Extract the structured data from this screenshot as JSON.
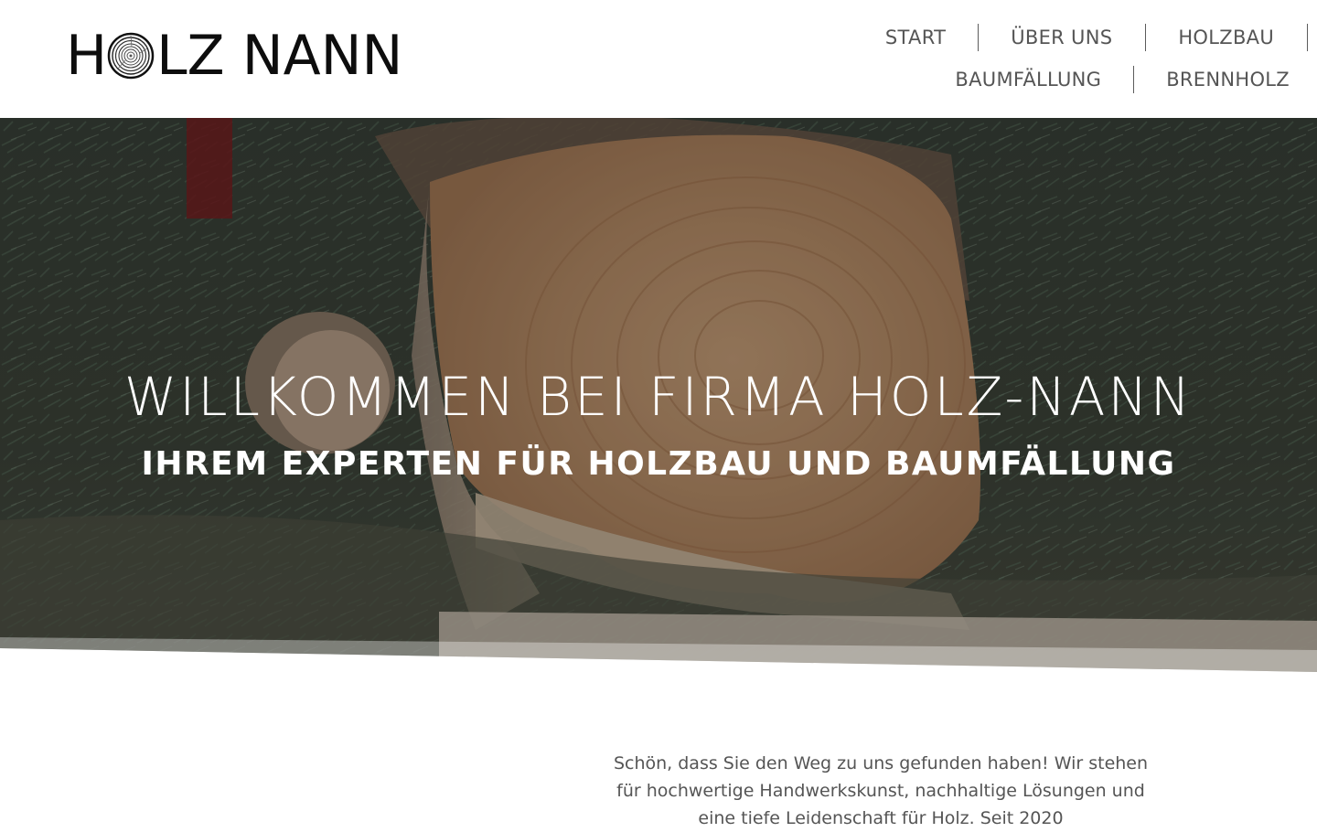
{
  "logo": {
    "before": "H",
    "ring_icon": "tree-ring-icon",
    "after": "LZ NANN"
  },
  "nav": {
    "row1": [
      {
        "label": "START"
      },
      {
        "label": "ÜBER UNS"
      },
      {
        "label": "HOLZBAU"
      }
    ],
    "row2": [
      {
        "label": "BAUMFÄLLUNG"
      },
      {
        "label": "BRENNHOLZ"
      }
    ]
  },
  "hero": {
    "title": "WILLKOMMEN BEI FIRMA HOLZ-NANN",
    "subtitle": "IHREM EXPERTEN FÜR HOLZBAU UND BAUMFÄLLUNG",
    "image": "felled-log-photo"
  },
  "intro": {
    "text": "Schön, dass Sie den Weg zu uns gefunden haben! Wir stehen für hochwertige Handwerkskunst, nachhaltige Lösungen und eine tiefe Leidenschaft für Holz. Seit 2020"
  },
  "colors": {
    "nav_text": "#555555",
    "logo_text": "#0d0d0d",
    "hero_text": "#ffffff",
    "body_text": "#555555"
  }
}
